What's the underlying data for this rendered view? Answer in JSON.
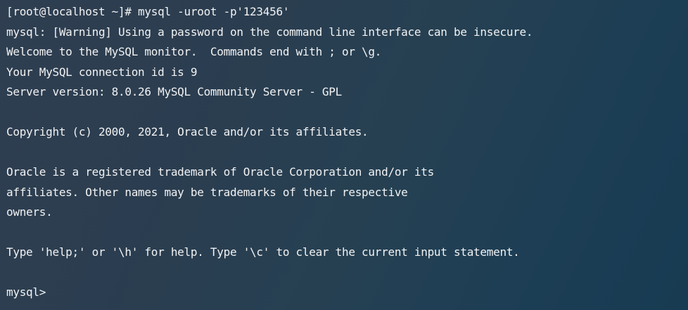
{
  "terminal": {
    "lines": [
      "[root@localhost ~]# mysql -uroot -p'123456'",
      "mysql: [Warning] Using a password on the command line interface can be insecure.",
      "Welcome to the MySQL monitor.  Commands end with ; or \\g.",
      "Your MySQL connection id is 9",
      "Server version: 8.0.26 MySQL Community Server - GPL",
      "",
      "Copyright (c) 2000, 2021, Oracle and/or its affiliates.",
      "",
      "Oracle is a registered trademark of Oracle Corporation and/or its",
      "affiliates. Other names may be trademarks of their respective",
      "owners.",
      "",
      "Type 'help;' or '\\h' for help. Type '\\c' to clear the current input statement.",
      "",
      "mysql>"
    ]
  }
}
